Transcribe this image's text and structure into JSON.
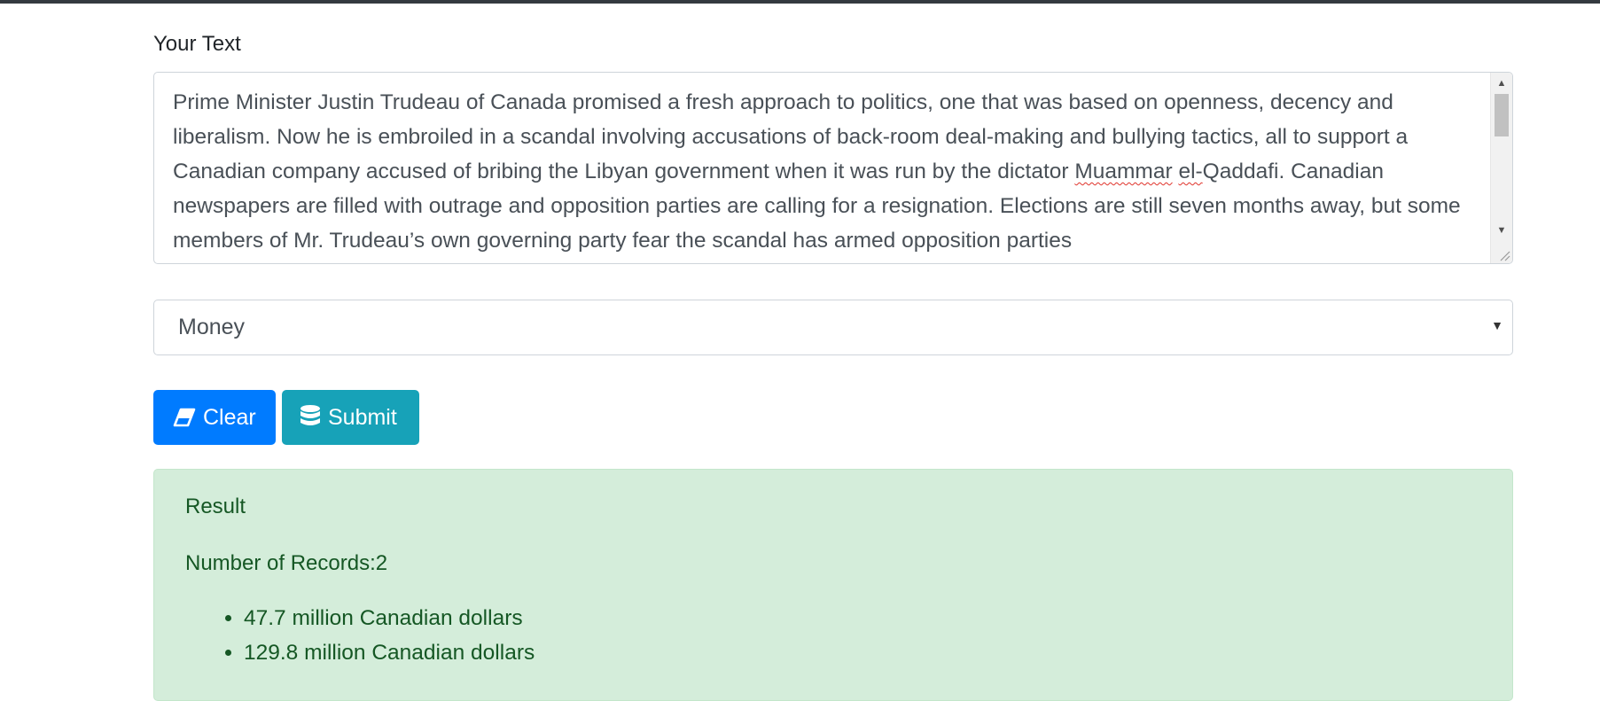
{
  "form": {
    "text_label": "Your Text",
    "textarea_value_parts": [
      "Prime Minister Justin Trudeau of Canada promised a fresh approach to politics, one that was based on openness, decency and liberalism. Now he is embroiled in a scandal involving accusations of back-room deal-making and bullying tactics, all to support a Canadian company accused of bribing the Libyan government when it was run by the dictator ",
      "Muammar",
      " ",
      "el-",
      "Qaddafi. Canadian newspapers are filled with outrage and opposition parties are calling for a resignation. Elections are still seven months away, but some members of Mr. Trudeau’s own governing party fear the scandal has armed opposition parties"
    ],
    "category_selected": "Money",
    "clear_label": "Clear",
    "submit_label": "Submit"
  },
  "result": {
    "title": "Result",
    "count_text": "Number of Records:2",
    "items": [
      "47.7 million Canadian dollars",
      "129.8 million Canadian dollars"
    ]
  },
  "icons": {
    "clear": "eraser-icon",
    "submit": "database-icon",
    "select": "caret-down-icon"
  },
  "colors": {
    "clear_button": "#007bff",
    "submit_button": "#17a2b8",
    "result_bg": "#d4edda",
    "result_text": "#155724"
  }
}
